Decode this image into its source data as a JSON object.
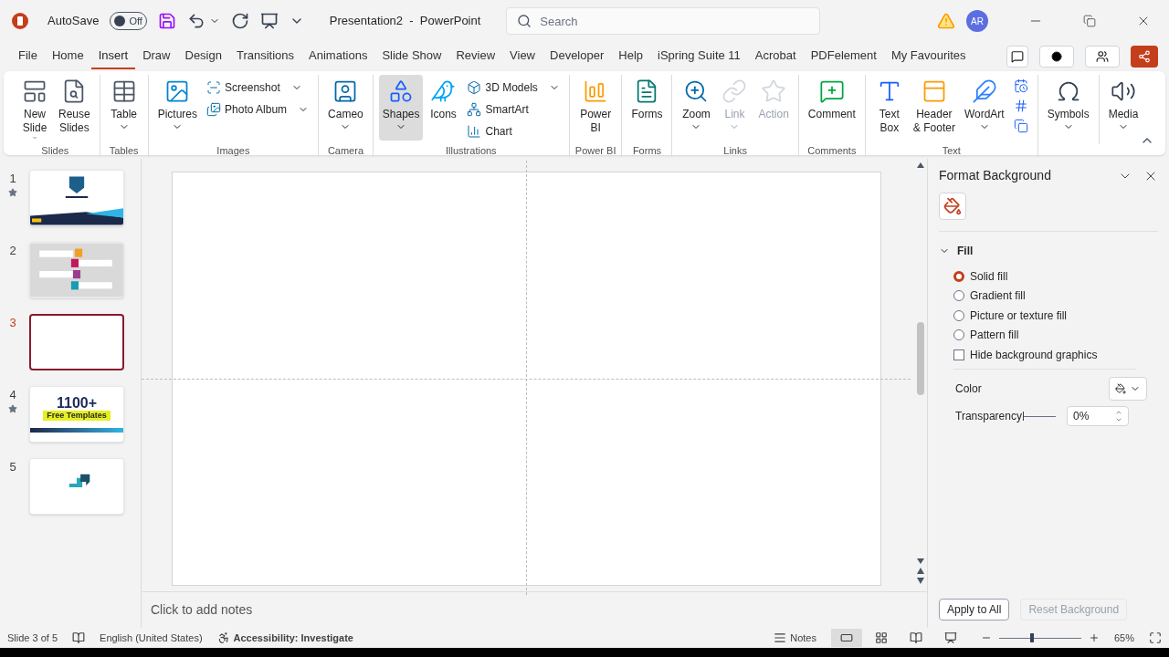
{
  "title_bar": {
    "autosave_label": "AutoSave",
    "autosave": {
      "on": false,
      "label": "Off"
    },
    "title": "Presentation2  -  PowerPoint",
    "search_placeholder": "Search",
    "avatar": "AR"
  },
  "menu_tabs": [
    {
      "label": "File",
      "selected": false
    },
    {
      "label": "Home",
      "selected": false
    },
    {
      "label": "Insert",
      "selected": true
    },
    {
      "label": "Draw",
      "selected": false
    },
    {
      "label": "Design",
      "selected": false
    },
    {
      "label": "Transitions",
      "selected": false
    },
    {
      "label": "Animations",
      "selected": false
    },
    {
      "label": "Slide Show",
      "selected": false
    },
    {
      "label": "Review",
      "selected": false
    },
    {
      "label": "View",
      "selected": false
    },
    {
      "label": "Developer",
      "selected": false
    },
    {
      "label": "Help",
      "selected": false
    },
    {
      "label": "iSpring Suite 11",
      "selected": false
    },
    {
      "label": "Acrobat",
      "selected": false
    },
    {
      "label": "PDFelement",
      "selected": false
    },
    {
      "label": "My Favourites",
      "selected": false
    }
  ],
  "ribbon_groups": [
    {
      "label": "Slides",
      "items": [
        {
          "kind": "large",
          "lines": [
            "New",
            "Slide"
          ],
          "dropdown": true,
          "disabled": false,
          "highlighted": false
        },
        {
          "kind": "large",
          "lines": [
            "Reuse",
            "Slides"
          ],
          "dropdown": false,
          "disabled": false,
          "highlighted": false
        }
      ]
    },
    {
      "label": "Tables",
      "items": [
        {
          "kind": "large",
          "lines": [
            "Table"
          ],
          "dropdown": true,
          "disabled": false,
          "highlighted": false
        }
      ]
    },
    {
      "label": "Images",
      "items": [
        {
          "kind": "large",
          "lines": [
            "Pictures"
          ],
          "dropdown": true,
          "disabled": false,
          "highlighted": false
        },
        {
          "kind": "stack",
          "entries": [
            {
              "label": "Screenshot",
              "dropdown": true
            },
            {
              "label": "Photo Album",
              "dropdown": true
            }
          ]
        }
      ]
    },
    {
      "label": "Camera",
      "items": [
        {
          "kind": "large",
          "lines": [
            "Cameo"
          ],
          "dropdown": true,
          "disabled": false,
          "highlighted": false
        }
      ]
    },
    {
      "label": "Illustrations",
      "items": [
        {
          "kind": "large",
          "lines": [
            "Shapes"
          ],
          "dropdown": true,
          "disabled": false,
          "highlighted": true
        },
        {
          "kind": "large",
          "lines": [
            "Icons"
          ],
          "dropdown": false,
          "disabled": false,
          "highlighted": false
        },
        {
          "kind": "stack",
          "entries": [
            {
              "label": "3D Models",
              "dropdown": true
            },
            {
              "label": "SmartArt",
              "dropdown": false
            },
            {
              "label": "Chart",
              "dropdown": false
            }
          ]
        }
      ]
    },
    {
      "label": "Power BI",
      "items": [
        {
          "kind": "large",
          "lines": [
            "Power",
            "BI"
          ],
          "dropdown": false,
          "disabled": false,
          "highlighted": false
        }
      ]
    },
    {
      "label": "Forms",
      "items": [
        {
          "kind": "large",
          "lines": [
            "Forms"
          ],
          "dropdown": false,
          "disabled": false,
          "highlighted": false
        }
      ]
    },
    {
      "label": "Links",
      "items": [
        {
          "kind": "large",
          "lines": [
            "Zoom"
          ],
          "dropdown": true,
          "disabled": false,
          "highlighted": false
        },
        {
          "kind": "large",
          "lines": [
            "Link"
          ],
          "dropdown": true,
          "disabled": true,
          "highlighted": false
        },
        {
          "kind": "large",
          "lines": [
            "Action"
          ],
          "dropdown": false,
          "disabled": true,
          "highlighted": false
        }
      ]
    },
    {
      "label": "Comments",
      "items": [
        {
          "kind": "large",
          "lines": [
            "Comment"
          ],
          "dropdown": false,
          "disabled": false,
          "highlighted": false
        }
      ]
    },
    {
      "label": "Text",
      "items": [
        {
          "kind": "large",
          "lines": [
            "Text",
            "Box"
          ],
          "dropdown": false,
          "disabled": false,
          "highlighted": false
        },
        {
          "kind": "large",
          "lines": [
            "Header",
            "& Footer"
          ],
          "dropdown": false,
          "disabled": false,
          "highlighted": false
        },
        {
          "kind": "large",
          "lines": [
            "WordArt"
          ],
          "dropdown": true,
          "disabled": false,
          "highlighted": false
        },
        {
          "kind": "icon_column"
        }
      ]
    },
    {
      "items": [
        {
          "kind": "large",
          "lines": [
            "Symbols"
          ],
          "dropdown": true,
          "disabled": false,
          "highlighted": false
        }
      ]
    },
    {
      "items": [
        {
          "kind": "large",
          "lines": [
            "Media"
          ],
          "dropdown": true,
          "disabled": false,
          "highlighted": false
        }
      ]
    }
  ],
  "thumbnails": [
    {
      "number": "1",
      "selected": false,
      "starred": true,
      "kind": "title"
    },
    {
      "number": "2",
      "selected": false,
      "starred": false,
      "kind": "process"
    },
    {
      "number": "3",
      "selected": true,
      "starred": false,
      "kind": "blank"
    },
    {
      "number": "4",
      "selected": false,
      "starred": true,
      "kind": "promo",
      "headline": "1100+",
      "tag": "Free Templates"
    },
    {
      "number": "5",
      "selected": false,
      "starred": false,
      "kind": "logo"
    }
  ],
  "notes_placeholder": "Click to add notes",
  "format_panel": {
    "title": "Format Background",
    "section": {
      "label": "Fill",
      "expanded": true
    },
    "fill_options": [
      {
        "label": "Solid fill",
        "selected": true
      },
      {
        "label": "Gradient fill",
        "selected": false
      },
      {
        "label": "Picture or texture fill",
        "selected": false
      },
      {
        "label": "Pattern fill",
        "selected": false
      }
    ],
    "hide_graphics": {
      "label": "Hide background graphics",
      "checked": false
    },
    "color_label": "Color",
    "transparency": {
      "label": "Transparency",
      "level": 0,
      "value": "0%"
    },
    "buttons": [
      {
        "label": "Apply to All",
        "disabled": false
      },
      {
        "label": "Reset Background",
        "disabled": true
      }
    ]
  },
  "status_bar": {
    "slide": "Slide 3 of 5",
    "language": "English (United States)",
    "accessibility": "Accessibility: Investigate",
    "notes": "Notes",
    "views": [
      {
        "selected": true
      },
      {
        "selected": false
      },
      {
        "selected": false
      },
      {
        "selected": false
      }
    ],
    "zoom": {
      "level": 0.4,
      "value": "65%"
    }
  }
}
